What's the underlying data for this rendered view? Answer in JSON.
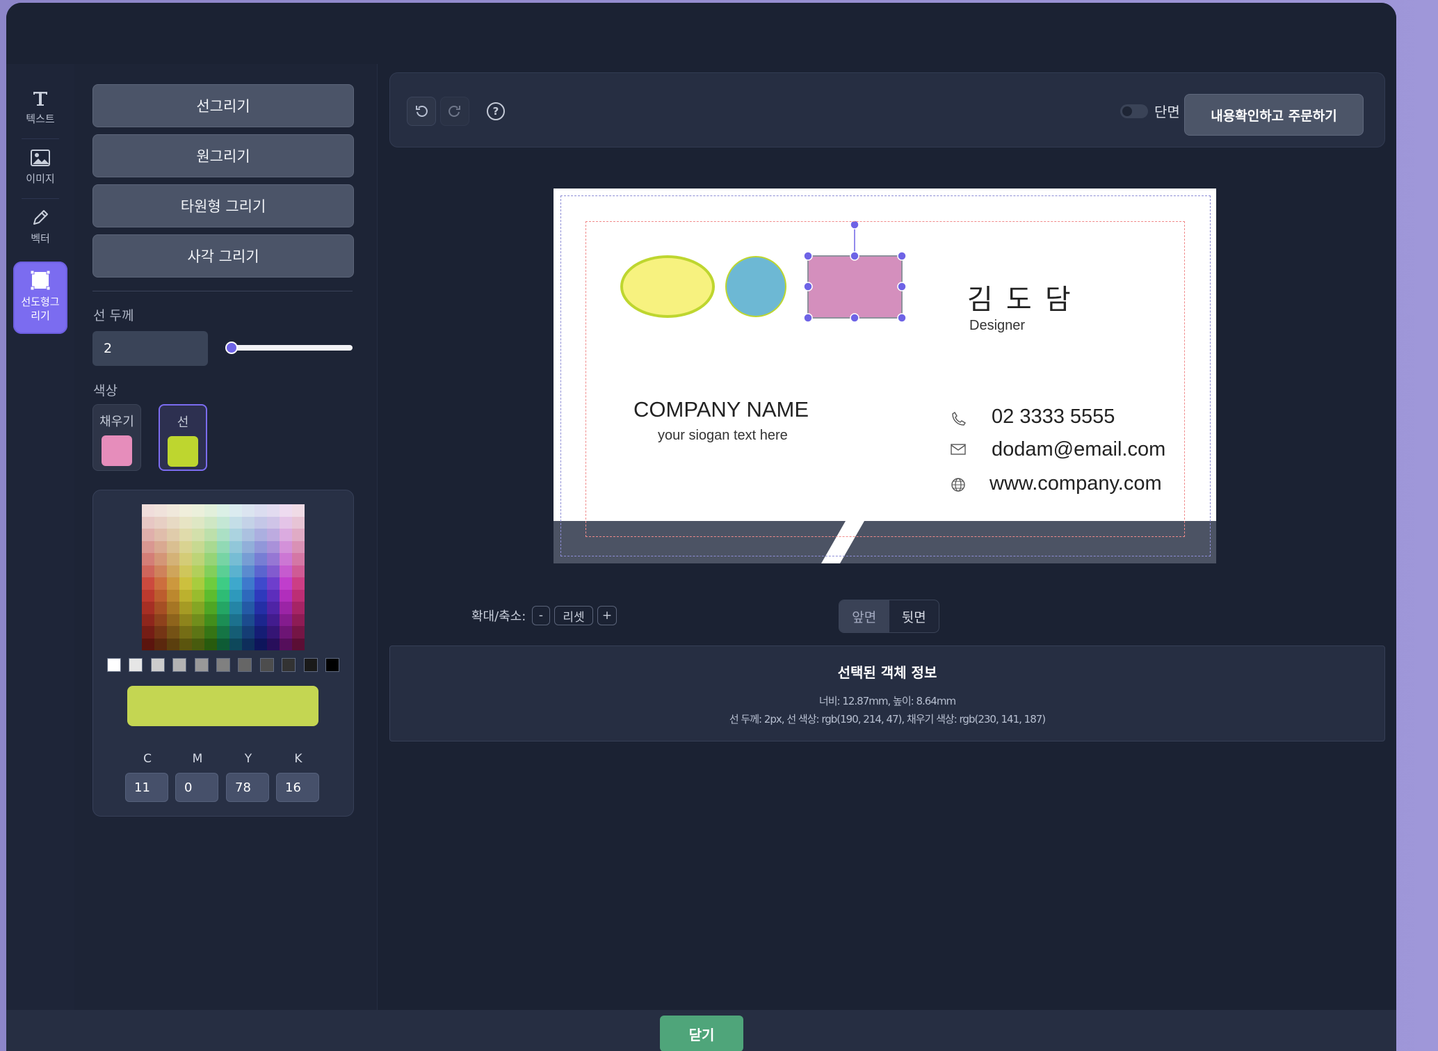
{
  "sidebar": {
    "tools": [
      {
        "label": "텍스트",
        "icon": "text-icon"
      },
      {
        "label": "이미지",
        "icon": "image-icon"
      },
      {
        "label": "벡터",
        "icon": "pen-icon"
      },
      {
        "label": "선도형그리기",
        "icon": "shape-icon",
        "active": true
      }
    ]
  },
  "panel": {
    "buttons": [
      "선그리기",
      "원그리기",
      "타원형 그리기",
      "사각 그리기"
    ],
    "line_width_label": "선 두께",
    "line_width_value": "2",
    "line_width_slider_fraction": 0.02,
    "color_label": "색상",
    "fill_label": "채우기",
    "stroke_label": "선",
    "fill_color": "#e68dbb",
    "stroke_color": "#bed62f",
    "preview_color": "#c4d652",
    "cmyk": {
      "labels": [
        "C",
        "M",
        "Y",
        "K"
      ],
      "values": [
        "11",
        "0",
        "78",
        "16"
      ]
    }
  },
  "toolbar": {
    "undo_icon": "undo-icon",
    "redo_icon": "redo-icon",
    "help_icon": "help-icon",
    "help_glyph": "?",
    "single_side_label": "단면",
    "order_button": "내용확인하고 주문하기"
  },
  "card": {
    "name": "김 도 담",
    "title": "Designer",
    "company": "COMPANY NAME",
    "slogan": "your siogan text here",
    "phone": "02 3333 5555",
    "email": "dodam@email.com",
    "website": "www.company.com"
  },
  "zoom": {
    "label": "확대/축소:",
    "minus": "-",
    "reset": "리셋",
    "plus": "+"
  },
  "sides": {
    "front": "앞면",
    "back": "뒷면",
    "selected": "front"
  },
  "info": {
    "title": "선택된 객체 정보",
    "size_line": "너비: 12.87mm, 높이: 8.64mm",
    "style_line": "선 두께: 2px, 선 색상: rgb(190, 214, 47), 채우기 색상: rgb(230, 141, 187)"
  },
  "footer": {
    "close_button": "닫기"
  }
}
